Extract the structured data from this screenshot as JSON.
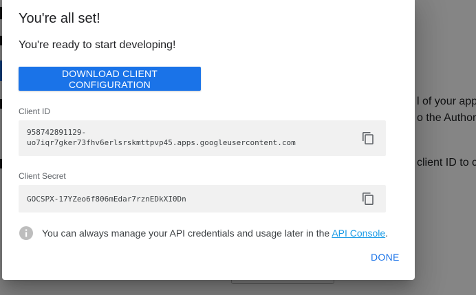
{
  "background": {
    "frag1": "l of your app",
    "frag2": "o the Authoriz",
    "frag3": "client ID to c"
  },
  "dialog": {
    "title": "You're all set!",
    "subtitle": "You're ready to start developing!",
    "download_button_label": "DOWNLOAD CLIENT CONFIGURATION",
    "client_id": {
      "label": "Client ID",
      "value_line1": "958742891129-",
      "value_line2": "uo7iqr7gker73fhv6erlsrskmttpvp45.apps.googleusercontent.com"
    },
    "client_secret": {
      "label": "Client Secret",
      "value": "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"
    },
    "info": {
      "text_before": "You can always manage your API credentials and usage later in the ",
      "link": "API Console",
      "text_after": "."
    },
    "done_label": "DONE"
  },
  "icons": {
    "copy": "copy-icon",
    "info": "info-icon"
  }
}
